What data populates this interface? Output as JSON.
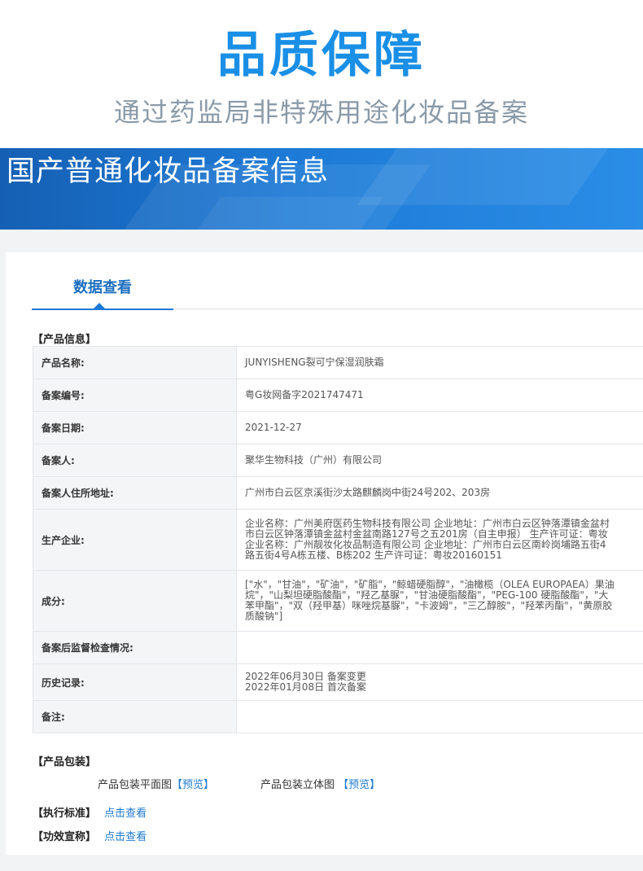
{
  "hero": {
    "title": "品质保障",
    "subtitle": "通过药监局非特殊用途化妆品备案"
  },
  "banner": {
    "title": "国产普通化妆品备案信息"
  },
  "tabs": {
    "active_label": "数据查看"
  },
  "product_info": {
    "section_label": "【产品信息】",
    "rows": [
      {
        "label": "产品名称:",
        "value": "JUNYISHENG裂可宁保湿润肤霜"
      },
      {
        "label": "备案编号:",
        "value": "粤G妆网备字2021747471"
      },
      {
        "label": "备案日期:",
        "value": "2021-12-27"
      },
      {
        "label": "备案人:",
        "value": "聚华生物科技（广州）有限公司"
      },
      {
        "label": "备案人住所地址:",
        "value": "广州市白云区京溪街沙太路麒麟岗中街24号202、203房"
      },
      {
        "label": "生产企业:",
        "lines": [
          "企业名称：广州美府医药生物科技有限公司 企业地址：广州市白云区钟落潭镇金盆村",
          "市白云区钟落潭镇金盆村金盆南路127号之五201房（自主申报） 生产许可证：粤妆",
          "企业名称：广州靓妆化妆品制造有限公司 企业地址：广州市白云区南岭岗埔路五街4",
          "路五街4号A栋五楼、B栋202 生产许可证：粤妆20160151"
        ]
      },
      {
        "label": "成分:",
        "lines": [
          "[\"水\"，\"甘油\"，\"矿油\"，\"矿脂\"，\"鲸蜡硬脂醇\"，\"油橄榄（OLEA EUROPAEA）果油",
          "烷\"，\"山梨坦硬脂酸酯\"，\"羟乙基脲\"，\"甘油硬脂酸酯\"，\"PEG-100 硬脂酸酯\"，\"大",
          "苯甲酯\"，\"双（羟甲基）咪唑烷基脲\"，\"卡波姆\"，\"三乙醇胺\"，\"羟苯丙酯\"，\"黄原胶",
          "质酸钠\"]"
        ]
      },
      {
        "label": "备案后监督检查情况:",
        "value": ""
      },
      {
        "label": "历史记录:",
        "lines": [
          "2022年06月30日 备案变更",
          "2022年01月08日 首次备案"
        ]
      },
      {
        "label": "备注:",
        "value": ""
      }
    ]
  },
  "packaging": {
    "section_label": "【产品包装】",
    "flat_label": "产品包装平面图",
    "flat_link": "【预览】",
    "stereo_label": "产品包装立体图",
    "stereo_link": "【预览】"
  },
  "standard": {
    "section_label": "【执行标准】",
    "link": "点击查看"
  },
  "efficacy": {
    "section_label": "【功效宣称】",
    "link": "点击查看"
  }
}
